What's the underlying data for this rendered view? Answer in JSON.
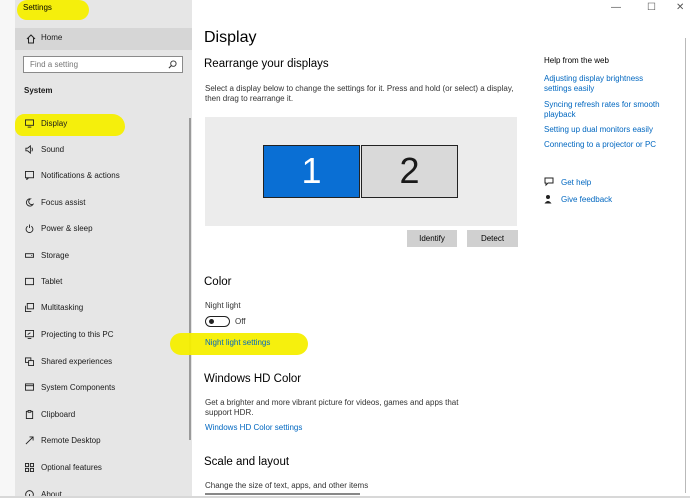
{
  "window": {
    "title": "Settings",
    "controls": {
      "minimize": "—",
      "maximize": "☐",
      "close": "✕"
    }
  },
  "sidebar": {
    "home_label": "Home",
    "search_placeholder": "Find a setting",
    "section_label": "System",
    "items": [
      {
        "label": "Display",
        "icon": "monitor-icon",
        "selected": true
      },
      {
        "label": "Sound",
        "icon": "speaker-icon"
      },
      {
        "label": "Notifications & actions",
        "icon": "notification-icon"
      },
      {
        "label": "Focus assist",
        "icon": "moon-icon"
      },
      {
        "label": "Power & sleep",
        "icon": "power-icon"
      },
      {
        "label": "Storage",
        "icon": "storage-icon"
      },
      {
        "label": "Tablet",
        "icon": "tablet-icon"
      },
      {
        "label": "Multitasking",
        "icon": "multitasking-icon"
      },
      {
        "label": "Projecting to this PC",
        "icon": "projecting-icon"
      },
      {
        "label": "Shared experiences",
        "icon": "shared-experiences-icon"
      },
      {
        "label": "System Components",
        "icon": "components-icon"
      },
      {
        "label": "Clipboard",
        "icon": "clipboard-icon"
      },
      {
        "label": "Remote Desktop",
        "icon": "remote-desktop-icon"
      },
      {
        "label": "Optional features",
        "icon": "optional-features-icon"
      },
      {
        "label": "About",
        "icon": "info-icon"
      }
    ]
  },
  "main": {
    "title": "Display",
    "rearrange": {
      "heading": "Rearrange your displays",
      "description": "Select a display below to change the settings for it. Press and hold (or select) a display, then drag to rearrange it.",
      "monitors": [
        "1",
        "2"
      ],
      "identify_label": "Identify",
      "detect_label": "Detect"
    },
    "color": {
      "heading": "Color",
      "night_light_label": "Night light",
      "night_light_state": "Off",
      "night_light_link": "Night light settings"
    },
    "hdr": {
      "heading": "Windows HD Color",
      "description": "Get a brighter and more vibrant picture for videos, games and apps that support HDR.",
      "link": "Windows HD Color settings"
    },
    "scale": {
      "heading": "Scale and layout",
      "description": "Change the size of text, apps, and other items"
    }
  },
  "help": {
    "heading": "Help from the web",
    "links": [
      "Adjusting display brightness settings easily",
      "Syncing refresh rates for smooth playback",
      "Setting up dual monitors easily",
      "Connecting to a projector or PC"
    ],
    "get_help": "Get help",
    "give_feedback": "Give feedback"
  },
  "colors": {
    "accent": "#0067c0",
    "selected_display": "#0a6fd4",
    "highlighter": "#f5ef00",
    "sidebar_bg": "#e6e6e6"
  }
}
